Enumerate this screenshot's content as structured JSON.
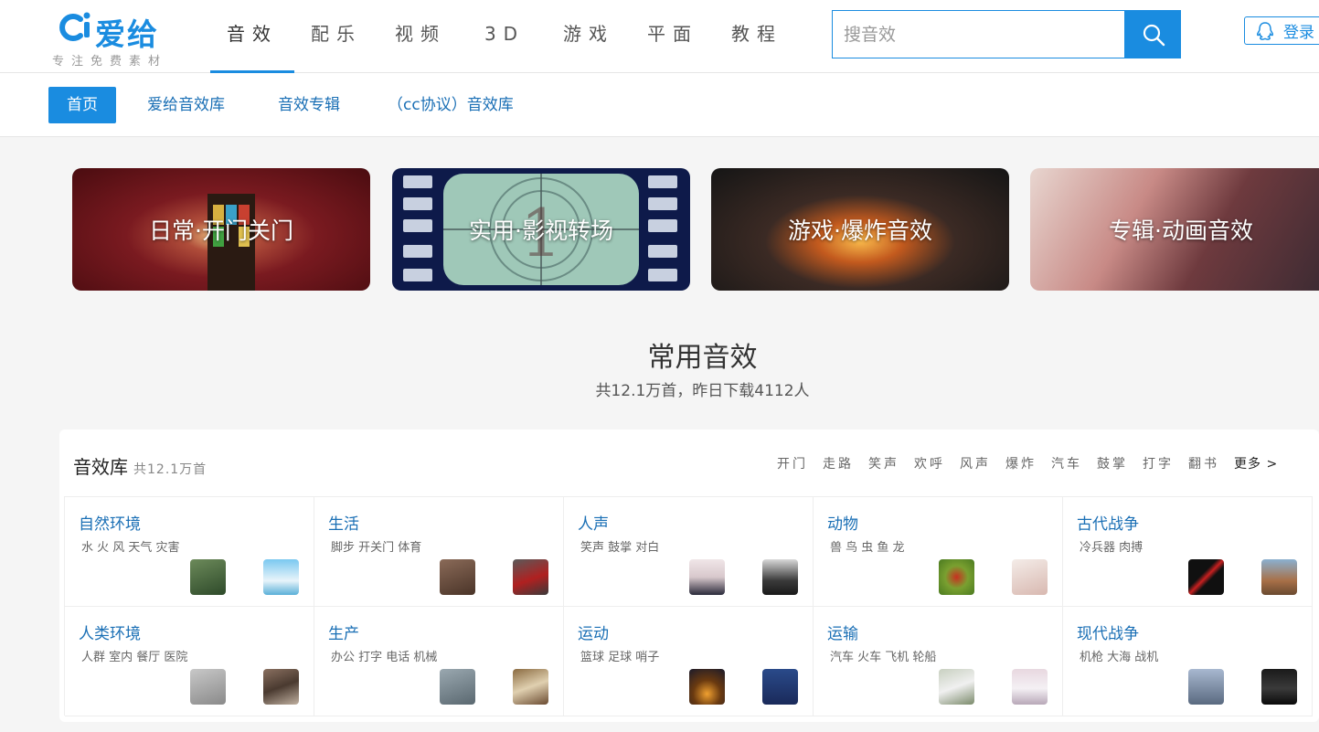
{
  "brand": {
    "name": "爱给",
    "slogan": "专注免费素材",
    "color": "#1a8ce0"
  },
  "main_nav": [
    {
      "label": "音效",
      "active": true
    },
    {
      "label": "配乐"
    },
    {
      "label": "视频"
    },
    {
      "label": "3D"
    },
    {
      "label": "游戏"
    },
    {
      "label": "平面"
    },
    {
      "label": "教程"
    }
  ],
  "search": {
    "placeholder": "搜音效",
    "icon": "search-icon"
  },
  "login": {
    "label": "登录",
    "icon": "qq-icon"
  },
  "sub_nav": [
    {
      "label": "首页",
      "active": true
    },
    {
      "label": "爱给音效库"
    },
    {
      "label": "音效专辑"
    },
    {
      "label": "（cc协议）音效库"
    }
  ],
  "banners": [
    {
      "label": "日常·开门关门"
    },
    {
      "label": "实用·影视转场"
    },
    {
      "label": "游戏·爆炸音效"
    },
    {
      "label": "专辑·动画音效"
    }
  ],
  "section": {
    "title": "常用音效",
    "subtitle": "共12.1万首，昨日下载4112人"
  },
  "library": {
    "title": "音效库",
    "count": "共12.1万首",
    "tags": [
      "开门",
      "走路",
      "笑声",
      "欢呼",
      "风声",
      "爆炸",
      "汽车",
      "鼓掌",
      "打字",
      "翻书"
    ],
    "more": "更多 >",
    "categories": [
      {
        "title": "自然环境",
        "sub": "水 火 风 天气 灾害"
      },
      {
        "title": "生活",
        "sub": "脚步 开关门 体育"
      },
      {
        "title": "人声",
        "sub": "笑声 鼓掌 对白"
      },
      {
        "title": "动物",
        "sub": "兽 鸟 虫 鱼 龙"
      },
      {
        "title": "古代战争",
        "sub": "冷兵器 肉搏"
      },
      {
        "title": "人类环境",
        "sub": "人群 室内 餐厅 医院"
      },
      {
        "title": "生产",
        "sub": "办公 打字 电话 机械"
      },
      {
        "title": "运动",
        "sub": "篮球 足球 哨子"
      },
      {
        "title": "运输",
        "sub": "汽车 火车 飞机 轮船"
      },
      {
        "title": "现代战争",
        "sub": "机枪 大海 战机"
      }
    ]
  }
}
